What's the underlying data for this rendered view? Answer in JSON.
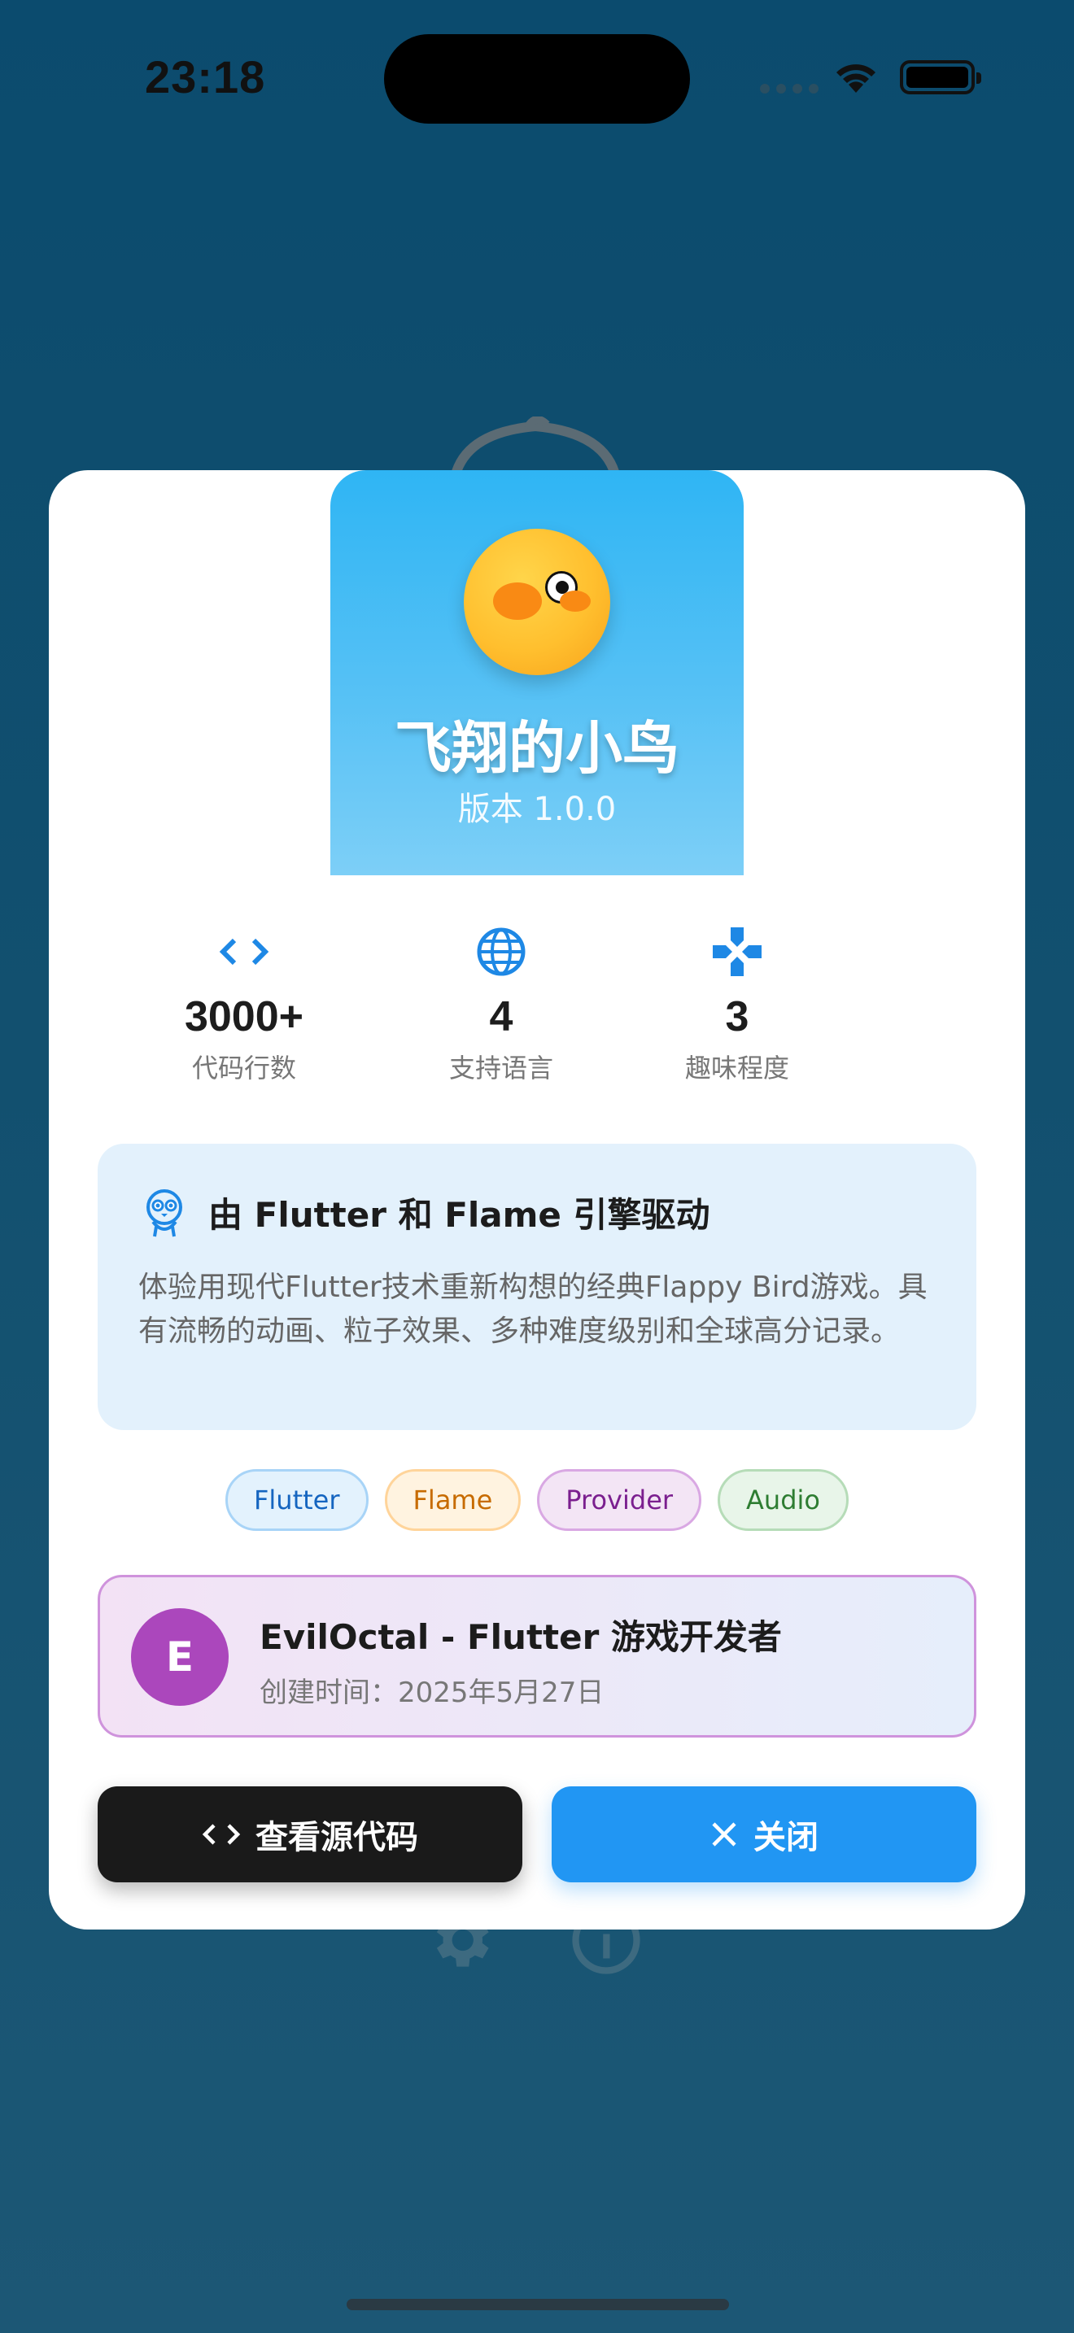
{
  "status_bar": {
    "time": "23:18",
    "icons": [
      "signal-dots-icon",
      "wifi-icon",
      "battery-icon"
    ]
  },
  "background": {
    "icons": [
      "bird-outline-icon",
      "gear-icon",
      "info-icon"
    ]
  },
  "dialog": {
    "hero": {
      "title": "飞翔的小鸟",
      "version": "版本 1.0.0",
      "mascot": "bird-icon"
    },
    "stats": [
      {
        "icon": "code-icon",
        "value": "3000+",
        "label": "代码行数"
      },
      {
        "icon": "globe-icon",
        "value": "4",
        "label": "支持语言"
      },
      {
        "icon": "gamepad-icon",
        "value": "3",
        "label": "趣味程度"
      }
    ],
    "info": {
      "icon": "flutter-dash-icon",
      "title": "由 Flutter 和 Flame 引擎驱动",
      "description": "体验用现代Flutter技术重新构想的经典Flappy Bird游戏。具有流畅的动画、粒子效果、多种难度级别和全球高分记录。"
    },
    "tags": [
      "Flutter",
      "Flame",
      "Provider",
      "Audio"
    ],
    "author": {
      "initial": "E",
      "name": "EvilOctal - Flutter 游戏开发者",
      "created": "创建时间：2025年5月27日"
    },
    "buttons": {
      "source_label": "查看源代码",
      "close_label": "关闭"
    }
  },
  "colors": {
    "primary": "#2196f3",
    "accent_purple": "#ab47bc",
    "hero_top": "#2fb5f4",
    "dark_button": "#1a1a1a"
  }
}
